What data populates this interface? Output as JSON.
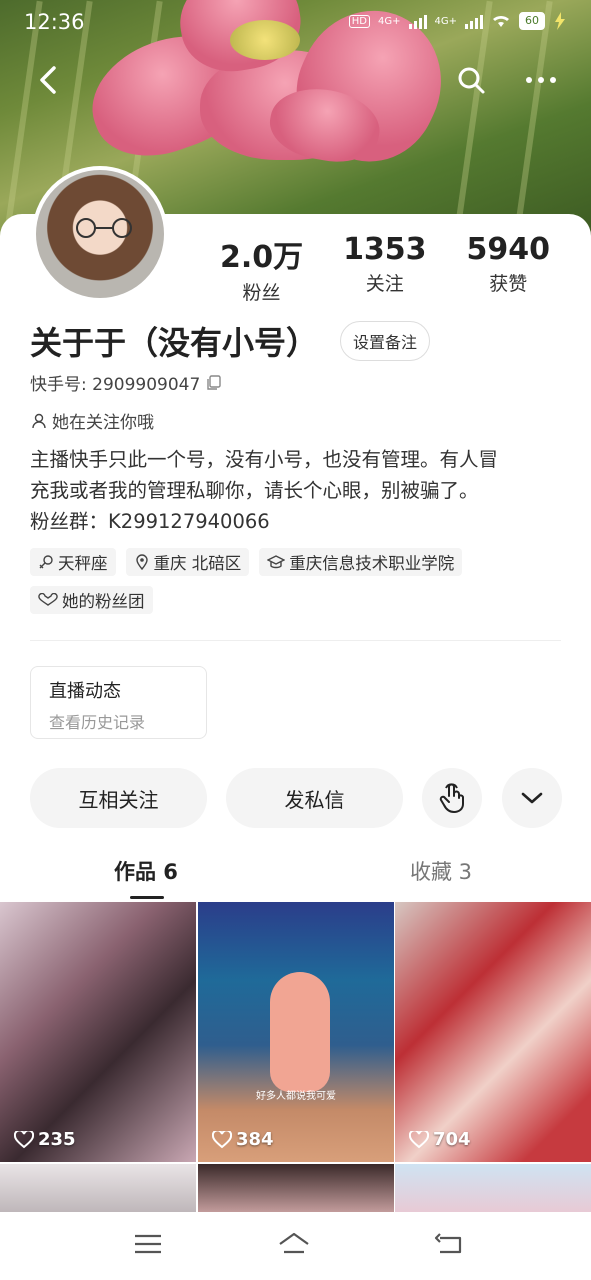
{
  "status_bar": {
    "time": "12:36",
    "network_1": "4G+",
    "network_2": "4G+",
    "hd_label": "HD",
    "battery": "60"
  },
  "profile": {
    "stats": [
      {
        "value": "2.0万",
        "label": "粉丝"
      },
      {
        "value": "1353",
        "label": "关注"
      },
      {
        "value": "5940",
        "label": "获赞"
      }
    ],
    "username": "关于于（没有小号）",
    "remark_button": "设置备注",
    "kuaishou_id": "快手号: 2909909047",
    "follows_you": "她在关注你哦",
    "bio_lines": [
      "主播快手只此一个号，没有小号，也没有管理。有人冒",
      "充我或者我的管理私聊你，请长个心眼，别被骗了。",
      "粉丝群：K299127940066"
    ],
    "tags": [
      {
        "icon": "zodiac-icon",
        "text": "天秤座"
      },
      {
        "icon": "location-icon",
        "text": "重庆 北碚区"
      },
      {
        "icon": "school-icon",
        "text": "重庆信息技术职业学院"
      },
      {
        "icon": "fan-club-icon",
        "text": "她的粉丝团"
      }
    ]
  },
  "live_card": {
    "title": "直播动态",
    "subtitle": "查看历史记录"
  },
  "actions": {
    "follow_back": "互相关注",
    "message": "发私信"
  },
  "tabs": [
    {
      "label": "作品 6",
      "active": true
    },
    {
      "label": "收藏 3",
      "active": false
    }
  ],
  "works": [
    {
      "likes": "235"
    },
    {
      "likes": "384",
      "caption": "好多人都说我可爱"
    },
    {
      "likes": "704"
    }
  ],
  "colors": {
    "accent": "#222222",
    "pill_bg": "#f4f4f4",
    "muted": "#999999"
  }
}
